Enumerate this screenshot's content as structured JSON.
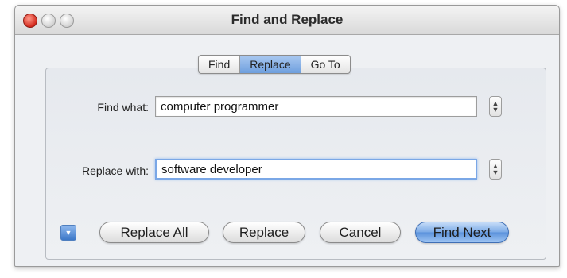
{
  "window": {
    "title": "Find and Replace"
  },
  "tabs": [
    {
      "label": "Find",
      "active": false
    },
    {
      "label": "Replace",
      "active": true
    },
    {
      "label": "Go To",
      "active": false
    }
  ],
  "find": {
    "label": "Find what:",
    "value": "computer programmer"
  },
  "replace": {
    "label": "Replace with:",
    "value": "software developer"
  },
  "buttons": {
    "replace_all": "Replace All",
    "replace": "Replace",
    "cancel": "Cancel",
    "find_next": "Find Next"
  },
  "colors": {
    "accent": "#6e9fde",
    "close": "#d42b1e",
    "window_bg": "#eef0f3"
  },
  "icons": {
    "stepper": "up-down-arrows",
    "disclosure": "chevron-down"
  }
}
